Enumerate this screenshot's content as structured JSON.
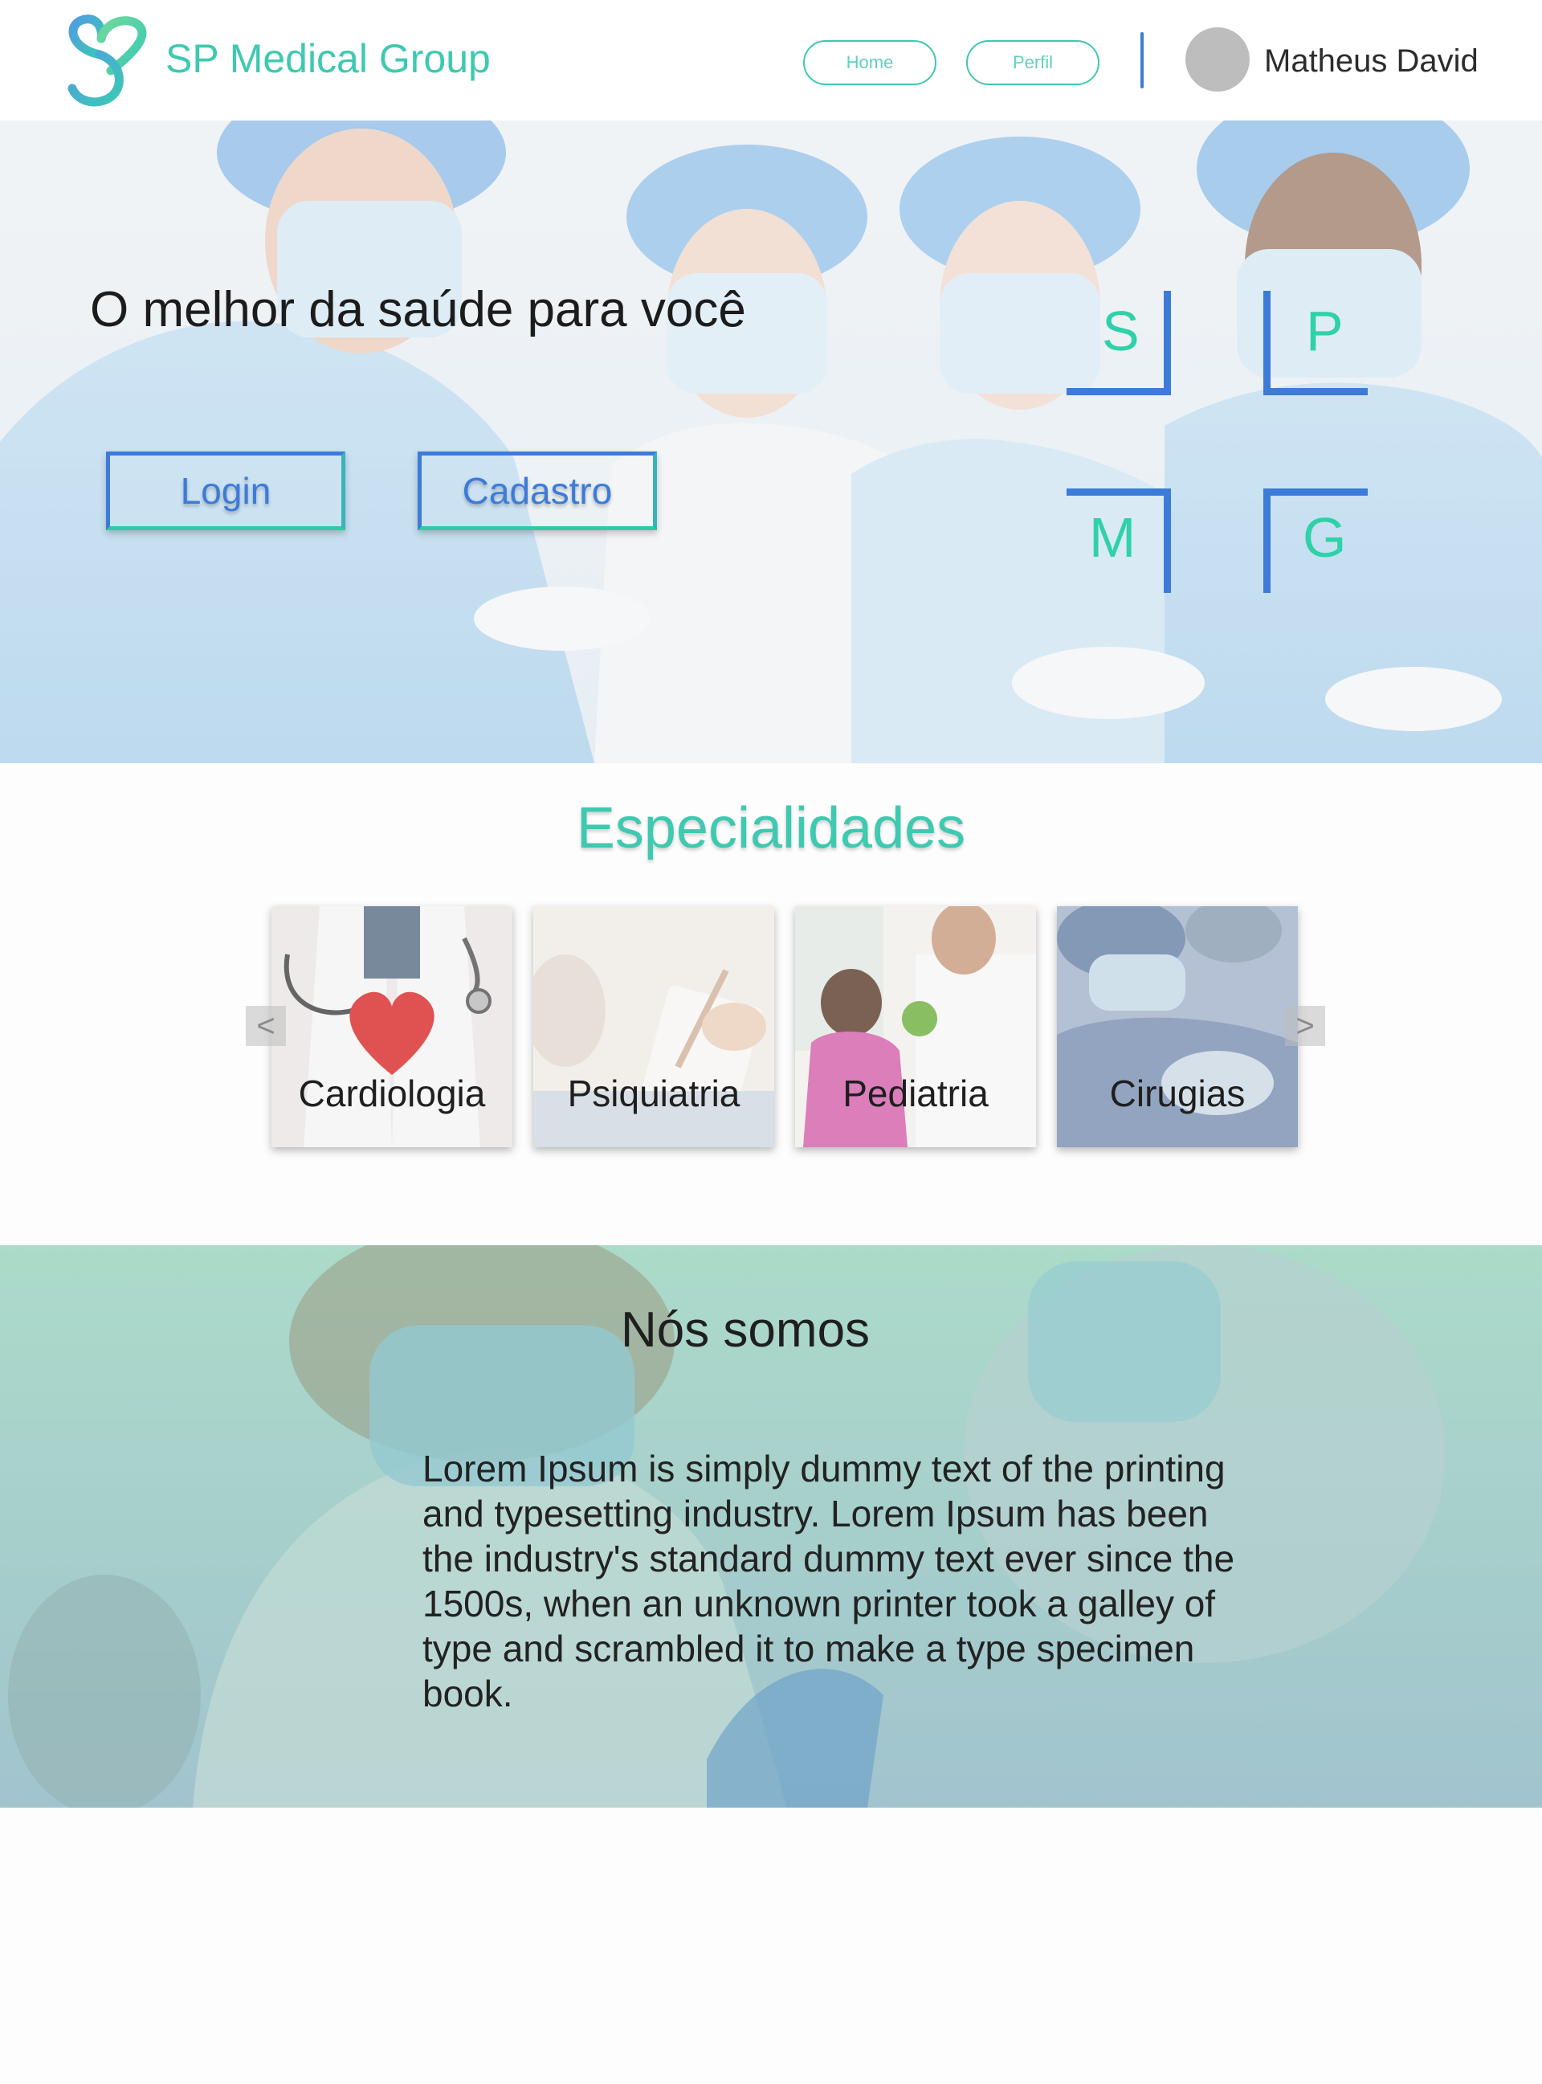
{
  "header": {
    "brand": "SP Medical Group",
    "nav": {
      "home": "Home",
      "perfil": "Perfil"
    },
    "user_name": "Matheus David"
  },
  "hero": {
    "title": "O melhor da saúde para você",
    "login_label": "Login",
    "cadastro_label": "Cadastro",
    "letters": [
      "S",
      "P",
      "M",
      "G"
    ]
  },
  "specialties": {
    "title": "Especialidades",
    "items": [
      {
        "label": "Cardiologia"
      },
      {
        "label": "Psiquiatria"
      },
      {
        "label": "Pediatria"
      },
      {
        "label": "Cirugias"
      }
    ],
    "prev_icon": "<",
    "next_icon": ">"
  },
  "about": {
    "title": "Nós somos",
    "text": "Lorem Ipsum is simply dummy text of the printing and typesetting industry. Lorem Ipsum has been the industry's standard dummy text ever since the 1500s, when an unknown printer took a galley of type and scrambled it to make a type specimen book."
  },
  "colors": {
    "brand_teal": "#3ec9b0",
    "accent_blue": "#3d7bd8",
    "letter_green": "#2fd1a8"
  }
}
